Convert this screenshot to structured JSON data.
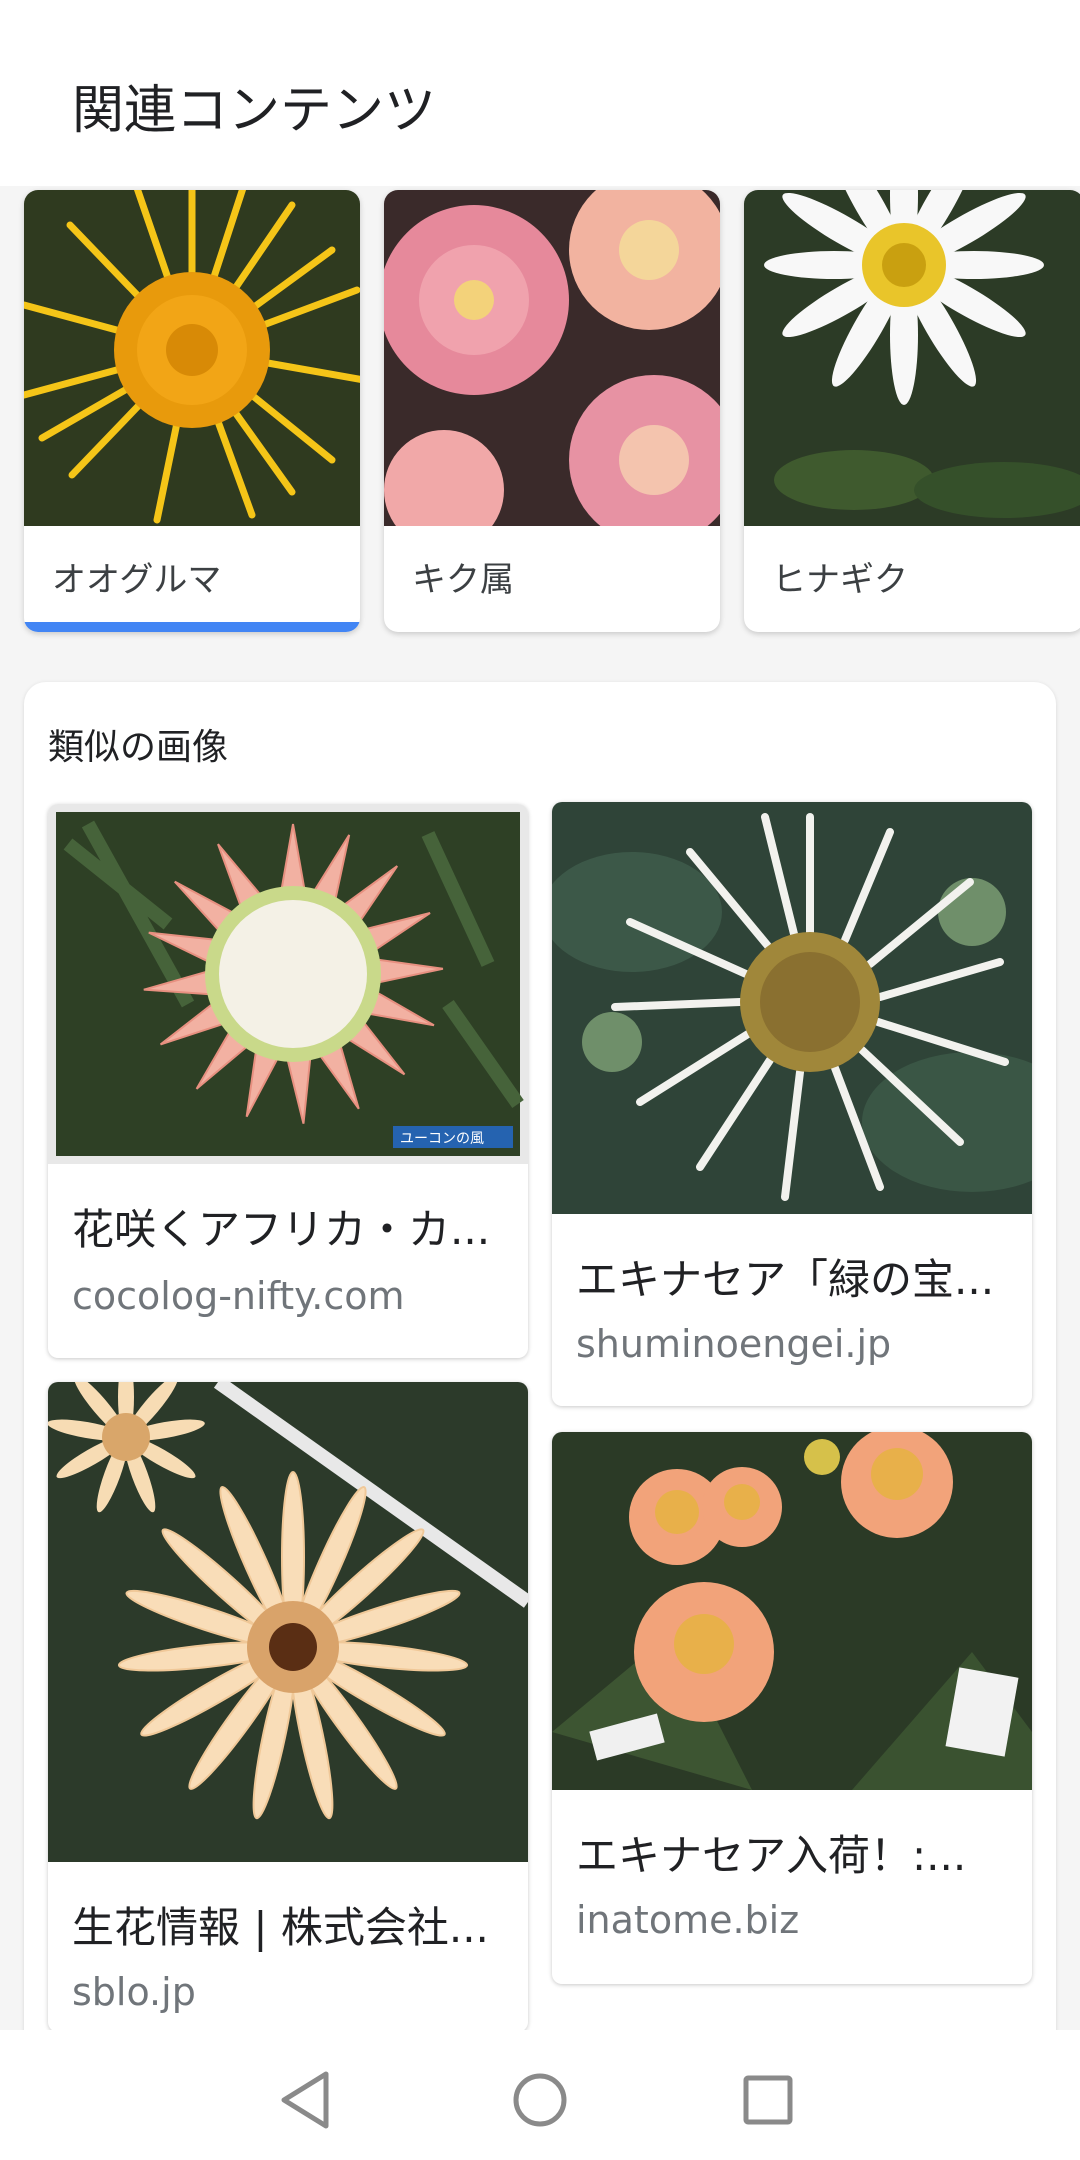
{
  "header": {
    "title": "関連コンテンツ"
  },
  "related": [
    {
      "label": "オオグルマ",
      "selected": true
    },
    {
      "label": "キク属",
      "selected": false
    },
    {
      "label": "ヒナギク",
      "selected": false
    }
  ],
  "similar": {
    "title": "類似の画像",
    "results": [
      {
        "title": "花咲くアフリカ・カ...",
        "source": "cocolog-nifty.com",
        "image_watermark": "ユーコンの風"
      },
      {
        "title": "エキナセア「緑の宝...",
        "source": "shuminoengei.jp"
      },
      {
        "title": "生花情報 | 株式会社...",
        "source": "sblo.jp"
      },
      {
        "title": "エキナセア入荷！:...",
        "source": "inatome.biz"
      }
    ]
  },
  "colors": {
    "accent": "#4285f4",
    "source_text": "#70757a"
  },
  "navbar": {
    "icons": [
      "back-icon",
      "home-icon",
      "recents-icon"
    ]
  }
}
